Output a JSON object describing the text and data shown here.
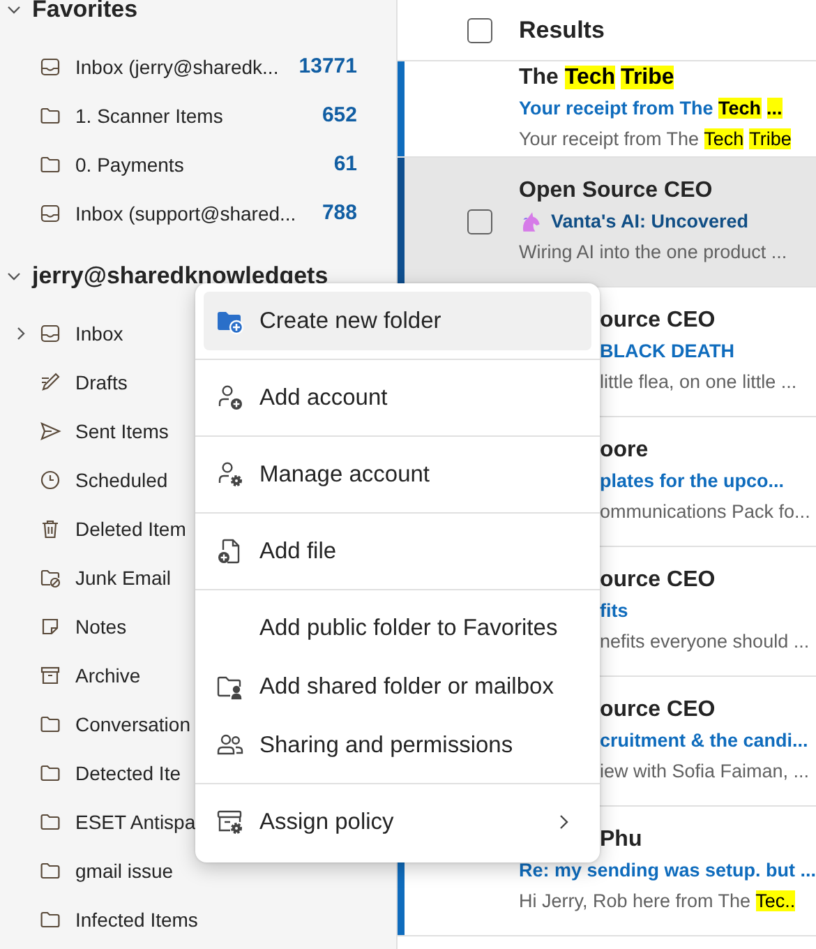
{
  "sidebar": {
    "favorites": {
      "title": "Favorites",
      "expanded": true,
      "items": [
        {
          "kind": "inbox",
          "label": "Inbox (jerry@sharedk...",
          "count": "13771"
        },
        {
          "kind": "folder",
          "label": "1. Scanner Items",
          "count": "652"
        },
        {
          "kind": "folder",
          "label": "0. Payments",
          "count": "61"
        },
        {
          "kind": "inbox",
          "label": "Inbox (support@shared...",
          "count": "788"
        }
      ]
    },
    "account": {
      "title": "jerry@sharedknowledgets",
      "expanded": true,
      "folders": [
        {
          "kind": "inbox",
          "label": "Inbox",
          "expanded": false
        },
        {
          "kind": "drafts",
          "label": "Drafts"
        },
        {
          "kind": "sent",
          "label": "Sent Items"
        },
        {
          "kind": "clock",
          "label": "Scheduled"
        },
        {
          "kind": "trash",
          "label": "Deleted Item"
        },
        {
          "kind": "junk",
          "label": "Junk Email"
        },
        {
          "kind": "note",
          "label": "Notes"
        },
        {
          "kind": "archive",
          "label": "Archive"
        },
        {
          "kind": "folder",
          "label": "Conversation"
        },
        {
          "kind": "folder",
          "label": "Detected Ite"
        },
        {
          "kind": "folder",
          "label": "ESET Antispa"
        },
        {
          "kind": "folder",
          "label": "gmail issue"
        },
        {
          "kind": "folder",
          "label": "Infected Items"
        }
      ]
    }
  },
  "list": {
    "header": {
      "title": "Results",
      "checked": false
    },
    "rows": [
      {
        "kind": "plain",
        "unread": true,
        "selected": false,
        "sender": {
          "covered": false,
          "parts": [
            {
              "text": "The ",
              "highlight": false
            },
            {
              "text": "Tech",
              "highlight": true
            },
            {
              "text": "Tribe",
              "highlight": true
            }
          ]
        },
        "subject": {
          "covered": false,
          "parts": [
            {
              "text": "Your receipt from The ",
              "highlight": false
            },
            {
              "text": "Tech",
              "highlight": true
            },
            {
              "text": "...",
              "highlight": true
            }
          ]
        },
        "preview": {
          "covered": false,
          "parts": [
            {
              "text": "Your receipt from The ",
              "highlight": false
            },
            {
              "text": "Tech",
              "highlight": true
            },
            {
              "text": "Tribe",
              "highlight": true
            }
          ]
        }
      },
      {
        "kind": "emoji",
        "unread": true,
        "selected": true,
        "sender": {
          "covered": false,
          "parts": [
            {
              "text": "Open Source CEO",
              "highlight": false
            }
          ]
        },
        "subject": {
          "covered": false,
          "parts": [
            {
              "text": "Vanta's AI: Uncovered",
              "highlight": false
            }
          ]
        },
        "preview": {
          "covered": false,
          "parts": [
            {
              "text": "Wiring AI into the one product ...",
              "highlight": false
            }
          ]
        }
      },
      {
        "kind": "plain",
        "selected": false,
        "sender": {
          "covered": true,
          "parts": [
            {
              "text": "ource CEO",
              "highlight": false
            }
          ]
        },
        "subject": {
          "covered": true,
          "parts": [
            {
              "text": "BLACK DEATH",
              "highlight": false
            }
          ]
        },
        "preview": {
          "covered": true,
          "parts": [
            {
              "text": "little flea, on one little ...",
              "highlight": false
            }
          ]
        }
      },
      {
        "kind": "plain",
        "selected": false,
        "sender": {
          "covered": true,
          "parts": [
            {
              "text": "oore",
              "highlight": false
            }
          ]
        },
        "subject": {
          "covered": true,
          "parts": [
            {
              "text": "plates for the upco...",
              "highlight": false
            }
          ]
        },
        "preview": {
          "covered": true,
          "parts": [
            {
              "text": "ommunications Pack fo...",
              "highlight": false
            }
          ]
        }
      },
      {
        "kind": "plain",
        "selected": false,
        "sender": {
          "covered": true,
          "parts": [
            {
              "text": "ource CEO",
              "highlight": false
            }
          ]
        },
        "subject": {
          "covered": true,
          "parts": [
            {
              "text": "fits",
              "highlight": false
            }
          ]
        },
        "preview": {
          "covered": true,
          "parts": [
            {
              "text": "nefits everyone should ...",
              "highlight": false
            }
          ]
        }
      },
      {
        "kind": "plain",
        "selected": false,
        "sender": {
          "covered": true,
          "parts": [
            {
              "text": "ource CEO",
              "highlight": false
            }
          ]
        },
        "subject": {
          "covered": true,
          "parts": [
            {
              "text": "cruitment & the candi...",
              "highlight": false
            }
          ]
        },
        "preview": {
          "covered": true,
          "parts": [
            {
              "text": "iew with Sofia Faiman, ...",
              "highlight": false
            }
          ]
        }
      },
      {
        "kind": "plain",
        "unread": true,
        "selected": false,
        "sender": {
          "covered": true,
          "parts": [
            {
              "text": "Phu",
              "highlight": false
            }
          ]
        },
        "subject": {
          "covered": false,
          "parts": [
            {
              "text": "Re: my sending was setup. but ...",
              "highlight": false
            }
          ]
        },
        "preview": {
          "covered": false,
          "parts": [
            {
              "text": "Hi Jerry, Rob here from The ",
              "highlight": false
            },
            {
              "text": "Tec..",
              "highlight": true
            }
          ]
        }
      }
    ]
  },
  "context_menu": {
    "groups": [
      [
        {
          "kind": "folder-add",
          "label": "Create new folder",
          "selected": true
        }
      ],
      [
        {
          "kind": "person-add",
          "label": "Add account",
          "selected": false
        }
      ],
      [
        {
          "kind": "person-gear",
          "label": "Manage account",
          "selected": false
        }
      ],
      [
        {
          "kind": "file-add",
          "label": "Add file",
          "selected": false
        }
      ],
      [
        {
          "kind": "none",
          "label": "Add public folder to Favorites",
          "selected": false
        },
        {
          "kind": "shared-folder",
          "label": "Add shared folder or mailbox",
          "selected": false
        },
        {
          "kind": "people",
          "label": "Sharing and permissions",
          "selected": false
        }
      ],
      [
        {
          "kind": "policy",
          "label": "Assign policy",
          "selected": false,
          "submenu": true
        }
      ]
    ]
  }
}
